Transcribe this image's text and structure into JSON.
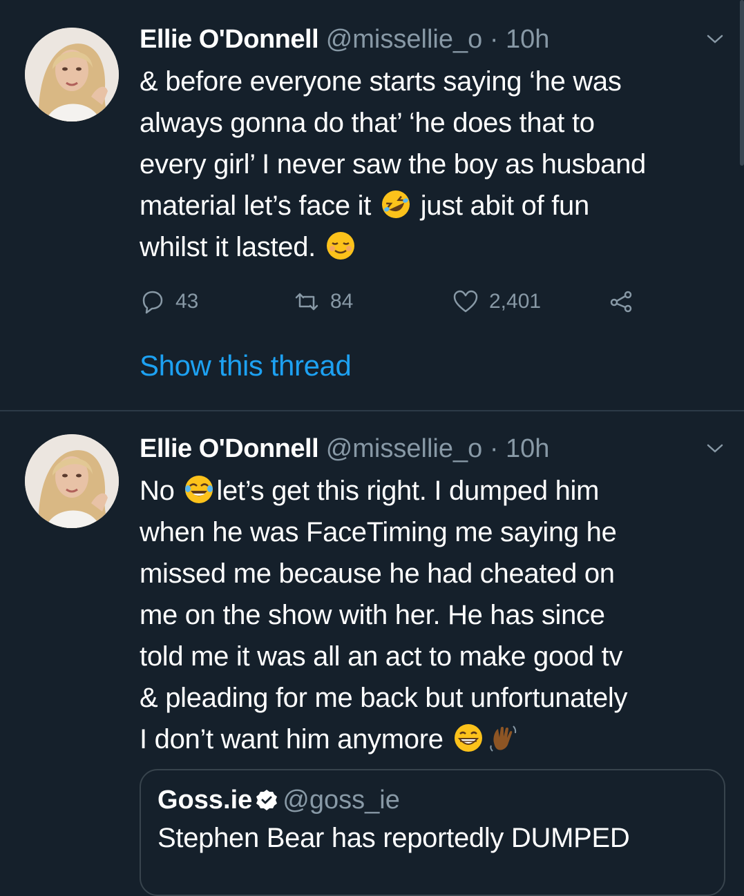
{
  "tweets": [
    {
      "author_name": "Ellie O'Donnell",
      "handle": "@missellie_o",
      "separator": "·",
      "time": "10h",
      "lines": [
        "& before everyone starts saying ‘he was",
        "always gonna do that’ ‘he does that to",
        "every girl’ I never saw the boy as husband",
        "material let’s face it",
        "just abit of fun",
        "whilst it lasted."
      ],
      "replies": "43",
      "retweets": "84",
      "likes": "2,401",
      "show_thread": "Show this thread",
      "icons": [
        "avatar",
        "chevron-down-icon",
        "rolling-laughing-emoji",
        "relieved-face-emoji",
        "reply-icon",
        "retweet-icon",
        "like-icon",
        "share-icon"
      ]
    },
    {
      "author_name": "Ellie O'Donnell",
      "handle": "@missellie_o",
      "separator": "·",
      "time": "10h",
      "lines": [
        "No",
        "let’s get this right. I dumped him",
        "when he was FaceTiming me saying he",
        "missed me because he had cheated on",
        "me on the show with her. He has since",
        "told me it was all an act to make good tv",
        "& pleading for me back but unfortunately",
        "I don’t want him anymore"
      ],
      "quoted": {
        "name": "Goss.ie",
        "handle": "@goss_ie",
        "text": "Stephen Bear has reportedly DUMPED"
      },
      "icons": [
        "avatar",
        "chevron-down-icon",
        "tears-of-joy-emoji",
        "grinning-face-emoji",
        "waving-hand-emoji",
        "verified-badge-icon"
      ]
    }
  ],
  "colors": {
    "background": "#15202b",
    "text": "#ffffff",
    "secondary": "#8899a6",
    "link": "#1da1f2",
    "border": "#38444d"
  }
}
